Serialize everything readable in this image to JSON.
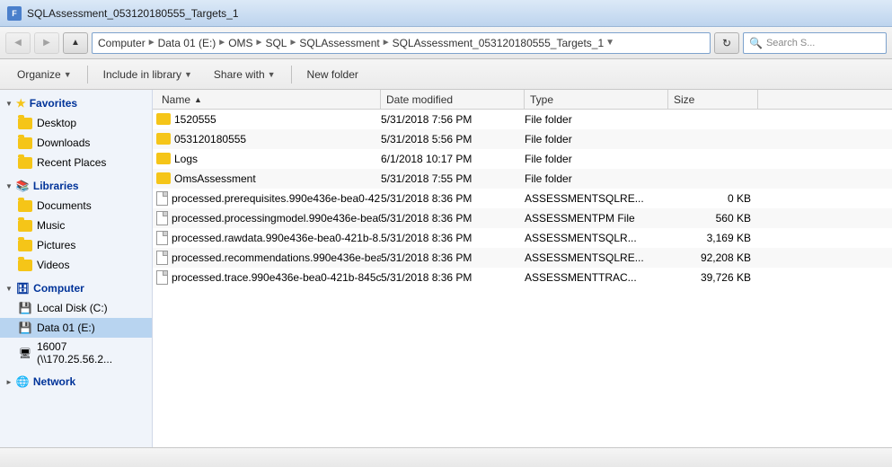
{
  "titleBar": {
    "title": "SQLAssessment_053120180555_Targets_1"
  },
  "addressBar": {
    "backBtn": "◄",
    "forwardBtn": "►",
    "upBtn": "▲",
    "pathSegments": [
      "Computer",
      "Data 01 (E:)",
      "OMS",
      "SQL",
      "SQLAssessment",
      "SQLAssessment_053120180555_Targets_1"
    ],
    "searchPlaceholder": "Search S...",
    "searchText": "Search S..."
  },
  "toolbar": {
    "organize": "Organize",
    "includeLibrary": "Include in library",
    "shareWith": "Share with",
    "newFolder": "New folder"
  },
  "sidebar": {
    "favorites": {
      "label": "Favorites",
      "items": [
        {
          "id": "desktop",
          "label": "Desktop"
        },
        {
          "id": "downloads",
          "label": "Downloads"
        },
        {
          "id": "recent-places",
          "label": "Recent Places"
        }
      ]
    },
    "libraries": {
      "label": "Libraries",
      "items": [
        {
          "id": "documents",
          "label": "Documents"
        },
        {
          "id": "music",
          "label": "Music"
        },
        {
          "id": "pictures",
          "label": "Pictures"
        },
        {
          "id": "videos",
          "label": "Videos"
        }
      ]
    },
    "computer": {
      "label": "Computer",
      "items": [
        {
          "id": "local-disk-c",
          "label": "Local Disk (C:)"
        },
        {
          "id": "data-01-e",
          "label": "Data 01 (E:)",
          "selected": true
        },
        {
          "id": "network-share",
          "label": "16007 (\\\\170.25.56.2..."
        }
      ]
    },
    "network": {
      "label": "Network"
    }
  },
  "columns": {
    "name": "Name",
    "dateModified": "Date modified",
    "type": "Type",
    "size": "Size"
  },
  "files": [
    {
      "id": 1,
      "type": "folder",
      "name": "1520555",
      "dateModified": "5/31/2018 7:56 PM",
      "fileType": "File folder",
      "size": ""
    },
    {
      "id": 2,
      "type": "folder",
      "name": "053120180555",
      "dateModified": "5/31/2018 5:56 PM",
      "fileType": "File folder",
      "size": ""
    },
    {
      "id": 3,
      "type": "folder",
      "name": "Logs",
      "dateModified": "6/1/2018 10:17 PM",
      "fileType": "File folder",
      "size": ""
    },
    {
      "id": 4,
      "type": "folder",
      "name": "OmsAssessment",
      "dateModified": "5/31/2018 7:55 PM",
      "fileType": "File folder",
      "size": ""
    },
    {
      "id": 5,
      "type": "file",
      "name": "processed.prerequisites.990e436e-bea0-42...",
      "dateModified": "5/31/2018 8:36 PM",
      "fileType": "ASSESSMENTSQLRE...",
      "size": "0 KB"
    },
    {
      "id": 6,
      "type": "file",
      "name": "processed.processingmodel.990e436e-bea0-...",
      "dateModified": "5/31/2018 8:36 PM",
      "fileType": "ASSESSMENTPM File",
      "size": "560 KB"
    },
    {
      "id": 7,
      "type": "file",
      "name": "processed.rawdata.990e436e-bea0-421b-8...",
      "dateModified": "5/31/2018 8:36 PM",
      "fileType": "ASSESSMENTSQLR...",
      "size": "3,169 KB"
    },
    {
      "id": 8,
      "type": "file",
      "name": "processed.recommendations.990e436e-bea...",
      "dateModified": "5/31/2018 8:36 PM",
      "fileType": "ASSESSMENTSQLRE...",
      "size": "92,208 KB"
    },
    {
      "id": 9,
      "type": "file",
      "name": "processed.trace.990e436e-bea0-421b-845c-...",
      "dateModified": "5/31/2018 8:36 PM",
      "fileType": "ASSESSMENTTRAC...",
      "size": "39,726 KB"
    }
  ],
  "statusBar": {
    "text": ""
  }
}
